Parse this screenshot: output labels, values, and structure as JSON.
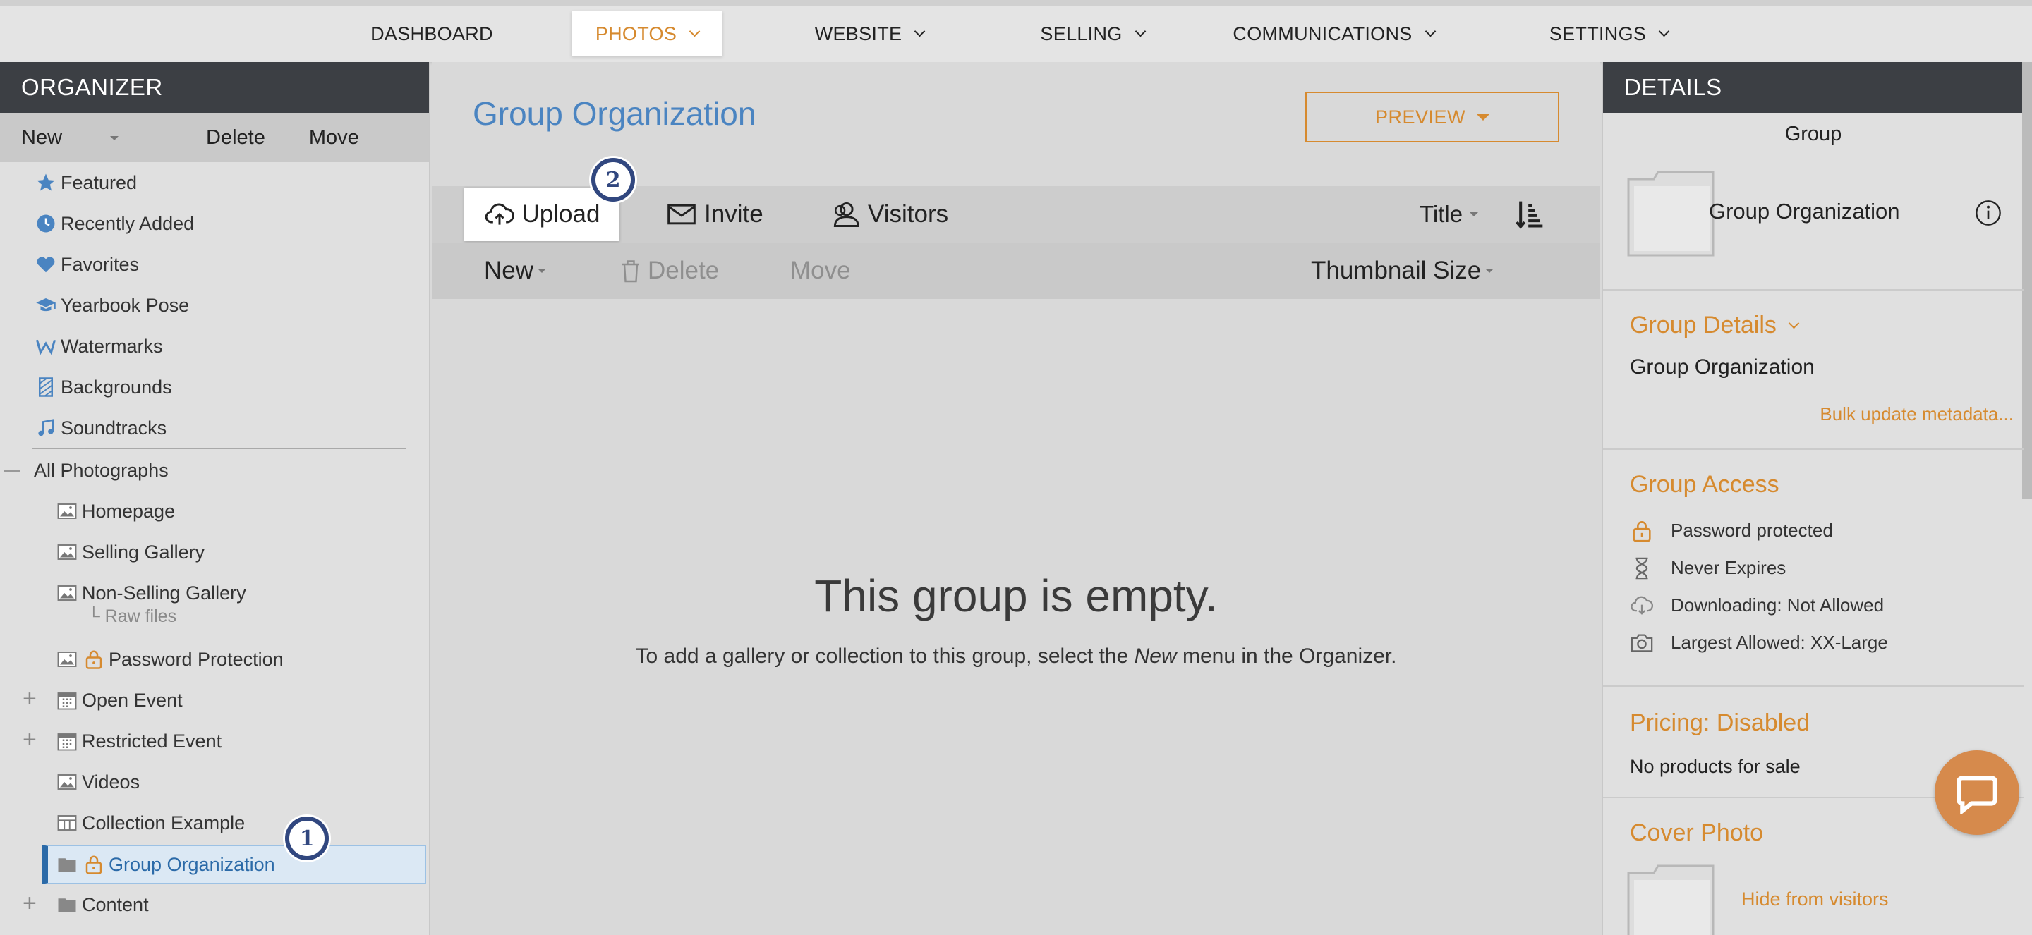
{
  "topnav": {
    "items": [
      {
        "label": "DASHBOARD"
      },
      {
        "label": "PHOTOS"
      },
      {
        "label": "WEBSITE"
      },
      {
        "label": "SELLING"
      },
      {
        "label": "COMMUNICATIONS"
      },
      {
        "label": "SETTINGS"
      }
    ],
    "active_color": "#d68a2f"
  },
  "organizer": {
    "title": "ORGANIZER",
    "toolbar": {
      "new": "New",
      "delete": "Delete",
      "move": "Move"
    },
    "special_items": [
      {
        "label": "Featured",
        "icon": "star-icon"
      },
      {
        "label": "Recently Added",
        "icon": "clock-icon"
      },
      {
        "label": "Favorites",
        "icon": "heart-icon"
      },
      {
        "label": "Yearbook Pose",
        "icon": "graduation-cap-icon"
      },
      {
        "label": "Watermarks",
        "icon": "watermark-w-icon"
      },
      {
        "label": "Backgrounds",
        "icon": "background-pattern-icon"
      },
      {
        "label": "Soundtracks",
        "icon": "music-note-icon"
      }
    ],
    "all_photographs": "All Photographs",
    "tree": [
      {
        "label": "Homepage",
        "icon": "gallery-image-icon"
      },
      {
        "label": "Selling Gallery",
        "icon": "gallery-image-icon"
      },
      {
        "label": "Non-Selling Gallery",
        "icon": "gallery-image-icon",
        "sub": "└ Raw files"
      },
      {
        "label": "Password Protection",
        "icon": "gallery-image-icon",
        "locked": true
      },
      {
        "label": "Open Event",
        "icon": "calendar-icon",
        "expandable": true
      },
      {
        "label": "Restricted Event",
        "icon": "calendar-icon",
        "expandable": true
      },
      {
        "label": "Videos",
        "icon": "gallery-image-icon"
      },
      {
        "label": "Collection Example",
        "icon": "collection-icon"
      },
      {
        "label": "Group Organization",
        "icon": "folder-icon",
        "locked": true,
        "selected": true
      },
      {
        "label": "Content",
        "icon": "folder-icon",
        "expandable": true
      }
    ],
    "badge_1": "1"
  },
  "main": {
    "title": "Group Organization",
    "preview_label": "PREVIEW",
    "actions": {
      "upload": "Upload",
      "invite": "Invite",
      "visitors": "Visitors",
      "sort": "Title"
    },
    "badge_2": "2",
    "subbar": {
      "new": "New",
      "delete": "Delete",
      "move": "Move",
      "thumbnail": "Thumbnail Size"
    },
    "empty_title": "This group is empty.",
    "empty_text_before": "To add a gallery or collection to this group, select the ",
    "empty_text_em": "New",
    "empty_text_after": " menu in the Organizer."
  },
  "details": {
    "title": "DETAILS",
    "type_label": "Group",
    "name": "Group Organization",
    "group_details_head": "Group Details",
    "group_details_value": "Group Organization",
    "bulk_link": "Bulk update metadata...",
    "access_head": "Group Access",
    "access_items": [
      {
        "label": "Password protected",
        "icon": "lock-icon"
      },
      {
        "label": "Never Expires",
        "icon": "hourglass-icon"
      },
      {
        "label": "Downloading: Not Allowed",
        "icon": "cloud-download-icon"
      },
      {
        "label": "Largest Allowed: XX-Large",
        "icon": "camera-icon"
      }
    ],
    "pricing_head": "Pricing: Disabled",
    "pricing_text": "No products for sale",
    "cover_head": "Cover Photo",
    "cover_link": "Hide from visitors"
  },
  "colors": {
    "accent": "#d68a2f",
    "link_blue": "#4a84c1",
    "header_dark": "#3c3f44",
    "badge_navy": "#31477f"
  }
}
